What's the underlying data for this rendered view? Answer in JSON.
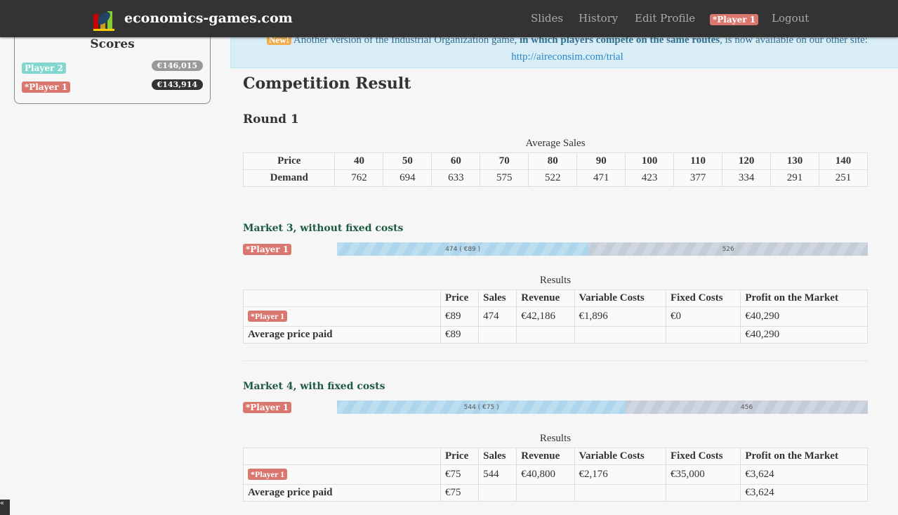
{
  "nav": {
    "brand": "economics-games.com",
    "links": [
      "Slides",
      "History",
      "Edit Profile"
    ],
    "player": "*Player 1",
    "logout": "Logout"
  },
  "scores": {
    "title": "Scores",
    "rows": [
      {
        "player": "Player 2",
        "score": "€146,015",
        "color": "#82d6d0"
      },
      {
        "player": "*Player 1",
        "score": "€143,914",
        "color": "#d9776f"
      }
    ]
  },
  "alert": {
    "badge": "New!",
    "text1": "Another version of the Industrial Organization game, ",
    "bold": "in which players compete on the same routes",
    "text2": ", is now available on our other site: ",
    "link": "http://aireconsim.com/trial"
  },
  "page_title": "Competition Result",
  "round": "Round 1",
  "avg_sales": {
    "caption": "Average Sales",
    "row_labels": [
      "Price",
      "Demand"
    ],
    "prices": [
      "40",
      "50",
      "60",
      "70",
      "80",
      "90",
      "100",
      "110",
      "120",
      "130",
      "140"
    ],
    "demand": [
      "762",
      "694",
      "633",
      "575",
      "522",
      "471",
      "423",
      "377",
      "334",
      "291",
      "251"
    ]
  },
  "headers": [
    "",
    "Price",
    "Sales",
    "Revenue",
    "Variable Costs",
    "Fixed Costs",
    "Profit on the Market"
  ],
  "markets": [
    {
      "title": "Market 3, without fixed costs",
      "player": "*Player 1",
      "share_percent": 47.4,
      "bar_label": "474 ( €89 )",
      "rest_label": "526",
      "caption": "Results",
      "rows": [
        [
          "*Player 1",
          "€89",
          "474",
          "€42,186",
          "€1,896",
          "€0",
          "€40,290"
        ],
        [
          "Average price paid",
          "€89",
          "",
          "",
          "",
          "",
          "€40,290"
        ]
      ]
    },
    {
      "title": "Market 4, with fixed costs",
      "player": "*Player 1",
      "share_percent": 54.4,
      "bar_label": "544 ( €75 )",
      "rest_label": "456",
      "caption": "Results",
      "rows": [
        [
          "*Player 1",
          "€75",
          "544",
          "€40,800",
          "€2,176",
          "€35,000",
          "€3,624"
        ],
        [
          "Average price paid",
          "€75",
          "",
          "",
          "",
          "",
          "€3,624"
        ]
      ]
    }
  ]
}
